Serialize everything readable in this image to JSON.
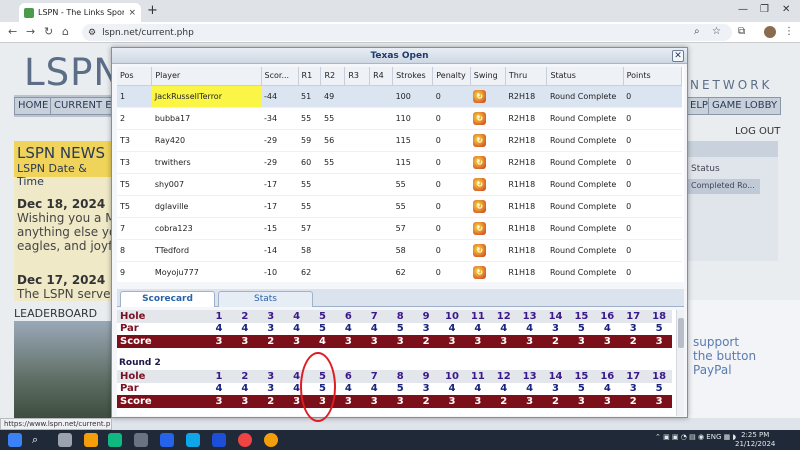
{
  "browser": {
    "tab_title": "LSPN - The Links Sports Network",
    "url": "lspn.net/current.php",
    "status_url": "https://www.lspn.net/current.php#"
  },
  "page": {
    "logo": "LSPN",
    "network": "NETWORK",
    "nav": [
      "HOME",
      "CURRENT EV",
      "ELP",
      "GAME LOBBY"
    ],
    "logout": "LOG OUT",
    "news_title": "LSPN NEWS",
    "news_sub": "LSPN Date & Time",
    "news": [
      {
        "date": "Dec 18, 2024",
        "lines": [
          "Wishing you a M",
          "anything else yo",
          "eagles, and joyfu"
        ]
      },
      {
        "date": "Dec 17, 2024",
        "lines": [
          "The LSPN server"
        ]
      }
    ],
    "leaderboard": "LEADERBOARD",
    "right_status": "Status",
    "right_row": "Completed Ro...",
    "support": [
      "support",
      "the button",
      "PayPal"
    ]
  },
  "dialog": {
    "title": "Texas Open",
    "columns": [
      "Pos",
      "Player",
      "Scor...",
      "R1",
      "R2",
      "R3",
      "R4",
      "Strokes",
      "Penalty",
      "Swing",
      "Thru",
      "Status",
      "Points"
    ],
    "rows": [
      {
        "pos": "1",
        "player": "JackRussellTerror",
        "score": "-44",
        "r1": "51",
        "r2": "49",
        "r3": "",
        "r4": "",
        "strokes": "100",
        "penalty": "0",
        "thru": "R2H18",
        "status": "Round Complete",
        "points": "0"
      },
      {
        "pos": "2",
        "player": "bubba17",
        "score": "-34",
        "r1": "55",
        "r2": "55",
        "r3": "",
        "r4": "",
        "strokes": "110",
        "penalty": "0",
        "thru": "R2H18",
        "status": "Round Complete",
        "points": "0"
      },
      {
        "pos": "T3",
        "player": "Ray420",
        "score": "-29",
        "r1": "59",
        "r2": "56",
        "r3": "",
        "r4": "",
        "strokes": "115",
        "penalty": "0",
        "thru": "R2H18",
        "status": "Round Complete",
        "points": "0"
      },
      {
        "pos": "T3",
        "player": "trwithers",
        "score": "-29",
        "r1": "60",
        "r2": "55",
        "r3": "",
        "r4": "",
        "strokes": "115",
        "penalty": "0",
        "thru": "R2H18",
        "status": "Round Complete",
        "points": "0"
      },
      {
        "pos": "T5",
        "player": "shy007",
        "score": "-17",
        "r1": "55",
        "r2": "",
        "r3": "",
        "r4": "",
        "strokes": "55",
        "penalty": "0",
        "thru": "R1H18",
        "status": "Round Complete",
        "points": "0"
      },
      {
        "pos": "T5",
        "player": "dglaville",
        "score": "-17",
        "r1": "55",
        "r2": "",
        "r3": "",
        "r4": "",
        "strokes": "55",
        "penalty": "0",
        "thru": "R1H18",
        "status": "Round Complete",
        "points": "0"
      },
      {
        "pos": "7",
        "player": "cobra123",
        "score": "-15",
        "r1": "57",
        "r2": "",
        "r3": "",
        "r4": "",
        "strokes": "57",
        "penalty": "0",
        "thru": "R1H18",
        "status": "Round Complete",
        "points": "0"
      },
      {
        "pos": "8",
        "player": "TTedford",
        "score": "-14",
        "r1": "58",
        "r2": "",
        "r3": "",
        "r4": "",
        "strokes": "58",
        "penalty": "0",
        "thru": "R1H18",
        "status": "Round Complete",
        "points": "0"
      },
      {
        "pos": "9",
        "player": "Moyoju777",
        "score": "-10",
        "r1": "62",
        "r2": "",
        "r3": "",
        "r4": "",
        "strokes": "62",
        "penalty": "0",
        "thru": "R1H18",
        "status": "Round Complete",
        "points": "0"
      }
    ],
    "tabs": [
      "Scorecard",
      "Stats"
    ],
    "labels": {
      "hole": "Hole",
      "par": "Par",
      "score": "Score"
    },
    "round2_label": "Round 2",
    "holes": [
      "1",
      "2",
      "3",
      "4",
      "5",
      "6",
      "7",
      "8",
      "9",
      "10",
      "11",
      "12",
      "13",
      "14",
      "15",
      "16",
      "17",
      "18"
    ],
    "round1": {
      "par": [
        "4",
        "4",
        "3",
        "4",
        "5",
        "4",
        "4",
        "5",
        "3",
        "4",
        "4",
        "4",
        "4",
        "3",
        "5",
        "4",
        "3",
        "5"
      ],
      "score": [
        "3",
        "3",
        "2",
        "3",
        "4",
        "3",
        "3",
        "3",
        "2",
        "3",
        "3",
        "3",
        "3",
        "2",
        "3",
        "3",
        "2",
        "3"
      ]
    },
    "round2": {
      "par": [
        "4",
        "4",
        "3",
        "4",
        "5",
        "4",
        "4",
        "5",
        "3",
        "4",
        "4",
        "4",
        "4",
        "3",
        "5",
        "4",
        "3",
        "5"
      ],
      "score": [
        "3",
        "3",
        "2",
        "3",
        "3",
        "3",
        "3",
        "3",
        "2",
        "3",
        "3",
        "2",
        "3",
        "2",
        "3",
        "3",
        "2",
        "3"
      ]
    }
  },
  "taskbar": {
    "lang": "ENG",
    "time": "2:25 PM",
    "date": "21/12/2024"
  }
}
